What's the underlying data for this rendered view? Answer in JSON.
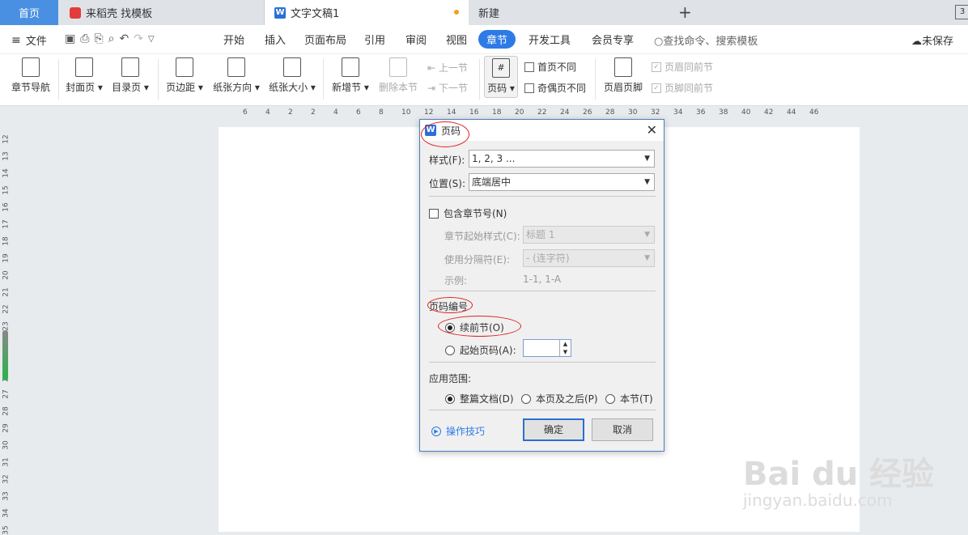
{
  "tabs": {
    "home": "首页",
    "daoke": "来稻壳 找模板",
    "doc": "文字文稿1",
    "new": "新建",
    "badge": "3"
  },
  "menubar": {
    "file": "文件",
    "tabs": [
      "开始",
      "插入",
      "页面布局",
      "引用",
      "审阅",
      "视图",
      "章节",
      "开发工具",
      "会员专享"
    ],
    "active": "章节",
    "search": "查找命令、搜索模板",
    "unsaved": "未保存"
  },
  "ribbon": {
    "nav": "章节导航",
    "cover": "封面页",
    "toc": "目录页",
    "margin": "页边距",
    "orientation": "纸张方向",
    "size": "纸张大小",
    "new_section": "新增节",
    "delete_section": "删除本节",
    "prev_section": "上一节",
    "next_section": "下一节",
    "page_number": "页码",
    "first_page_diff": "首页不同",
    "odd_even_diff": "奇偶页不同",
    "header_footer": "页眉页脚",
    "header_same": "页眉同前节",
    "footer_same": "页脚同前节"
  },
  "ruler_h": [
    "6",
    "4",
    "2",
    "2",
    "4",
    "6",
    "8",
    "10",
    "12",
    "14",
    "16",
    "18",
    "20",
    "22",
    "24",
    "26",
    "28",
    "30",
    "32",
    "34",
    "36",
    "38",
    "40",
    "42",
    "44",
    "46"
  ],
  "ruler_v": [
    "12",
    "13",
    "14",
    "15",
    "16",
    "17",
    "18",
    "19",
    "20",
    "21",
    "22",
    "23",
    "24",
    "25",
    "26",
    "27",
    "28",
    "29",
    "30",
    "31",
    "32",
    "33",
    "34",
    "35"
  ],
  "dialog": {
    "title": "页码",
    "style_label": "样式(F):",
    "style_value": "1, 2, 3 ...",
    "position_label": "位置(S):",
    "position_value": "底端居中",
    "include_chapter": "包含章节号(N)",
    "chapter_start_label": "章节起始样式(C):",
    "chapter_start_value": "标题 1",
    "separator_label": "使用分隔符(E):",
    "separator_value": "-    (连字符)",
    "example_label": "示例:",
    "example_value": "1-1, 1-A",
    "numbering_label": "页码编号",
    "continue_prev": "续前节(O)",
    "start_at": "起始页码(A):",
    "apply_label": "应用范围:",
    "apply_whole": "整篇文档(D)",
    "apply_after": "本页及之后(P)",
    "apply_section": "本节(T)",
    "tips": "操作技巧",
    "ok": "确定",
    "cancel": "取消"
  },
  "watermark": {
    "main": "Bai du 经验",
    "sub": "jingyan.baidu.com"
  }
}
